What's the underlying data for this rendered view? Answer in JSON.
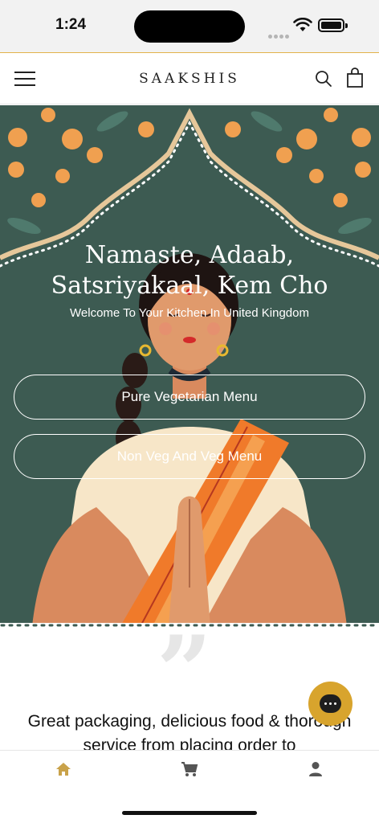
{
  "status": {
    "time": "1:24"
  },
  "header": {
    "brand": "SAAKSHIS"
  },
  "hero": {
    "title": "Namaste, Adaab, Satsriyakaal, Kem Cho",
    "subtitle": "Welcome To Your Kitchen In United Kingdom",
    "buttons": [
      "Pure Vegetarian Menu",
      "Non Veg And Veg Menu"
    ]
  },
  "review": {
    "quote_mark": "”",
    "text": "Great packaging, delicious food & thorough service from placing order to"
  },
  "colors": {
    "accent": "#d8a42d",
    "hero_bg": "#3d5b52",
    "tab_active": "#c9a24a",
    "tab_inactive": "#555555"
  },
  "icons": {
    "menu": "hamburger-icon",
    "search": "search-icon",
    "cart": "shopping-bag-icon",
    "chat": "chat-icon",
    "home": "home-icon",
    "tab_cart": "cart-icon",
    "account": "account-icon"
  }
}
